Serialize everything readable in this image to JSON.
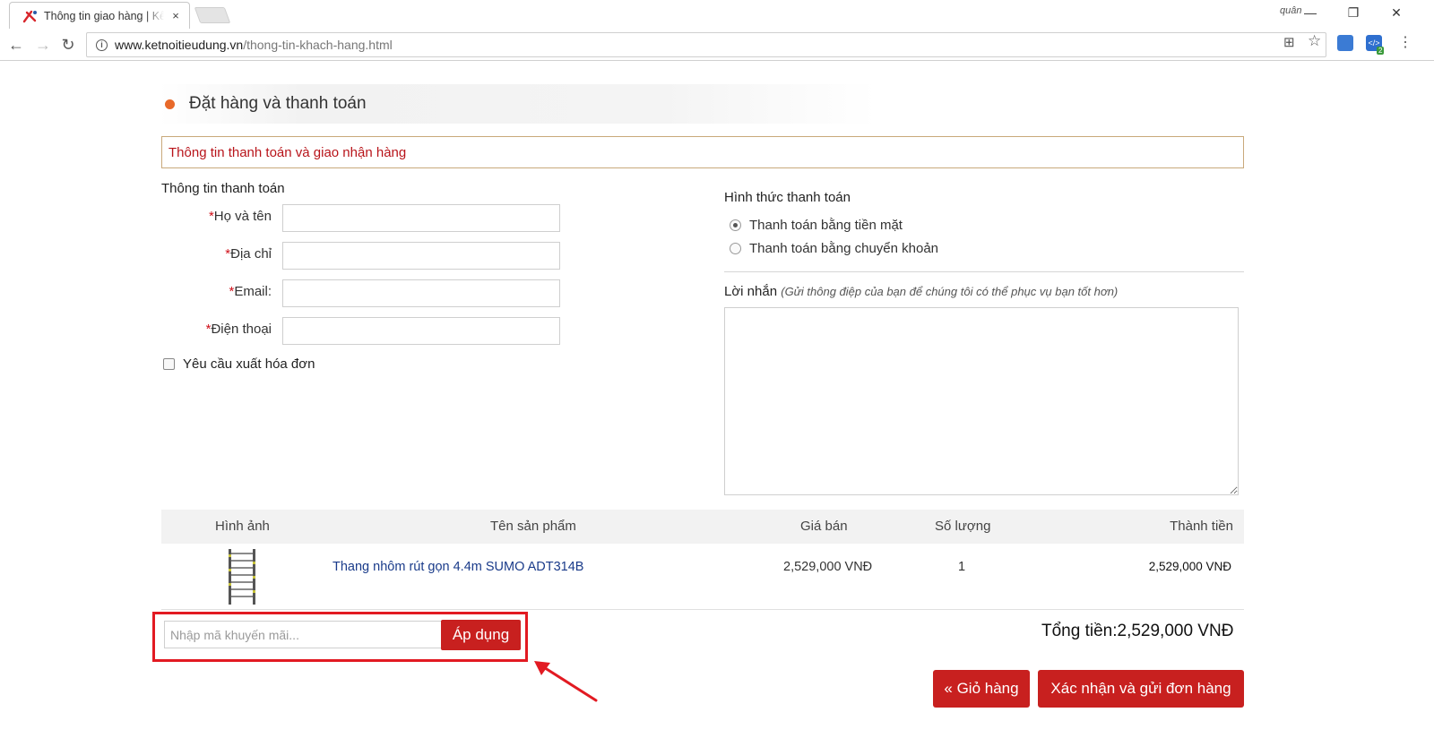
{
  "browser": {
    "tab_title": "Thông tin giao hàng | Kế",
    "tab_close": "×",
    "user_label": "quân",
    "url_domain": "www.ketnoitieudung.vn",
    "url_path": "/thong-tin-khach-hang.html",
    "ext_badge": "2"
  },
  "section": {
    "title": "Đặt hàng và thanh toán"
  },
  "banner": {
    "text": "Thông tin thanh toán và giao nhận hàng"
  },
  "billing": {
    "title": "Thông tin thanh toán",
    "required_mark": "*",
    "fields": [
      {
        "label": "Họ và tên",
        "value": ""
      },
      {
        "label": "Địa chỉ",
        "value": ""
      },
      {
        "label": "Email:",
        "value": ""
      },
      {
        "label": "Điện thoại",
        "value": ""
      }
    ],
    "invoice_label": "Yêu cầu xuất hóa đơn"
  },
  "payment": {
    "title": "Hình thức thanh toán",
    "options": [
      {
        "label": "Thanh toán bằng tiền mặt",
        "selected": true
      },
      {
        "label": "Thanh toán bằng chuyển khoản",
        "selected": false
      }
    ]
  },
  "message": {
    "label": "Lời nhắn",
    "hint": "(Gửi thông điệp của bạn để chúng tôi có thể phục vụ bạn tốt hơn)"
  },
  "cart": {
    "headers": [
      "Hình ảnh",
      "Tên sản phẩm",
      "Giá bán",
      "Số lượng",
      "Thành tiền"
    ],
    "rows": [
      {
        "name": "Thang nhôm rút gọn 4.4m SUMO ADT314B",
        "price": "2,529,000 VNĐ",
        "qty": "1",
        "subtotal": "2,529,000 VNĐ"
      }
    ]
  },
  "promo": {
    "placeholder": "Nhập mã khuyến mãi...",
    "apply_label": "Áp dụng"
  },
  "total": {
    "text": "Tổng tiền:2,529,000 VNĐ"
  },
  "actions": {
    "cart_label": "« Giỏ hàng",
    "confirm_label": "Xác nhận và gửi đơn hàng"
  },
  "colors": {
    "accent_red": "#c8201f",
    "highlight_red": "#e21a22",
    "bullet_orange": "#e8692a",
    "link_blue": "#1a3b8a"
  }
}
